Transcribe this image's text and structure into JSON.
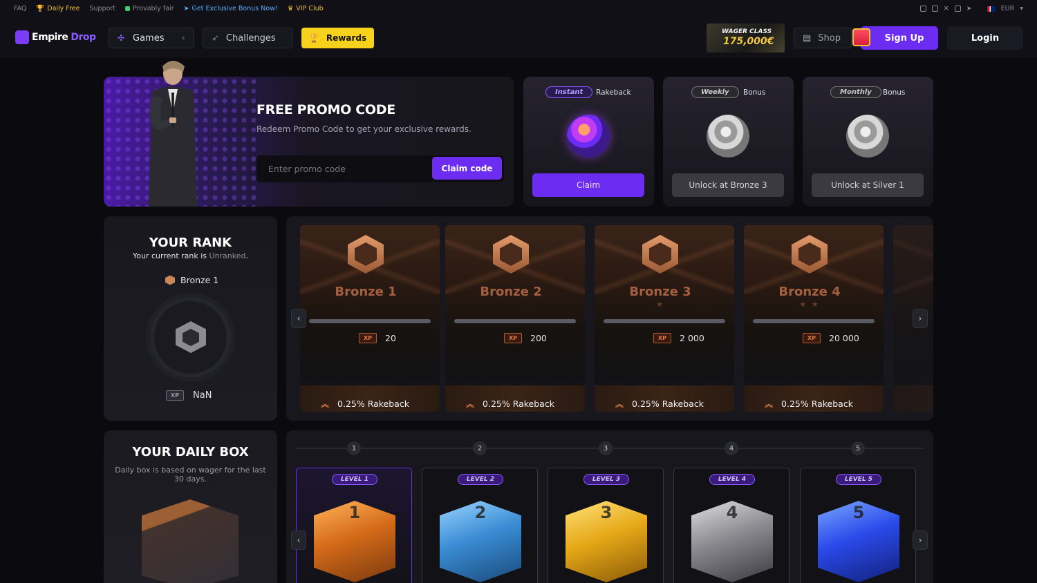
{
  "topbar": {
    "links": [
      "FAQ",
      "Daily Free",
      "Support",
      "Provably fair",
      "Get Exclusive Bonus Now!",
      "VIP Club"
    ],
    "currency": "EUR"
  },
  "nav": {
    "logo_a": "Empire",
    "logo_b": "Drop",
    "games": "Games",
    "challenges": "Challenges",
    "rewards": "Rewards",
    "wager_line1": "WAGER CLASS",
    "wager_line2": "175,000€",
    "shop": "Shop",
    "signup": "Sign Up",
    "login": "Login"
  },
  "promo": {
    "title": "FREE PROMO CODE",
    "subtitle": "Redeem Promo Code to get your exclusive rewards.",
    "placeholder": "Enter promo code",
    "button": "Claim code"
  },
  "rakeback": [
    {
      "pill": "Instant",
      "label": "Rakeback",
      "button": "Claim"
    },
    {
      "pill": "Weekly",
      "label": "Bonus",
      "button": "Unlock at Bronze 3"
    },
    {
      "pill": "Monthly",
      "label": "Bonus",
      "button": "Unlock at Silver 1"
    }
  ],
  "rank": {
    "title": "YOUR RANK",
    "sub_prefix": "Your current rank is ",
    "sub_value": "Unranked",
    "sub_suffix": ".",
    "next": "Bronze 1",
    "xp_tag": "XP",
    "xp_value": "NaN"
  },
  "rank_cards": [
    {
      "name": "Bronze 1",
      "stars": "",
      "xp": "20",
      "rakeback": "0.25% Rakeback"
    },
    {
      "name": "Bronze 2",
      "stars": "",
      "xp": "200",
      "rakeback": "0.25% Rakeback"
    },
    {
      "name": "Bronze 3",
      "stars": "★",
      "xp": "2 000",
      "rakeback": "0.25% Rakeback"
    },
    {
      "name": "Bronze 4",
      "stars": "★ ★",
      "xp": "20 000",
      "rakeback": "0.25% Rakeback"
    }
  ],
  "daily": {
    "title": "YOUR DAILY BOX",
    "subtitle": "Daily box is based on wager for the last 30 days."
  },
  "levels": [
    {
      "num": "1",
      "label": "LEVEL 1",
      "cube_num": "1"
    },
    {
      "num": "2",
      "label": "LEVEL 2",
      "cube_num": "2"
    },
    {
      "num": "3",
      "label": "LEVEL 3",
      "cube_num": "3"
    },
    {
      "num": "4",
      "label": "LEVEL 4",
      "cube_num": "4"
    },
    {
      "num": "5",
      "label": "LEVEL 5",
      "cube_num": "5"
    }
  ],
  "arrows": {
    "left": "‹",
    "right": "›"
  }
}
